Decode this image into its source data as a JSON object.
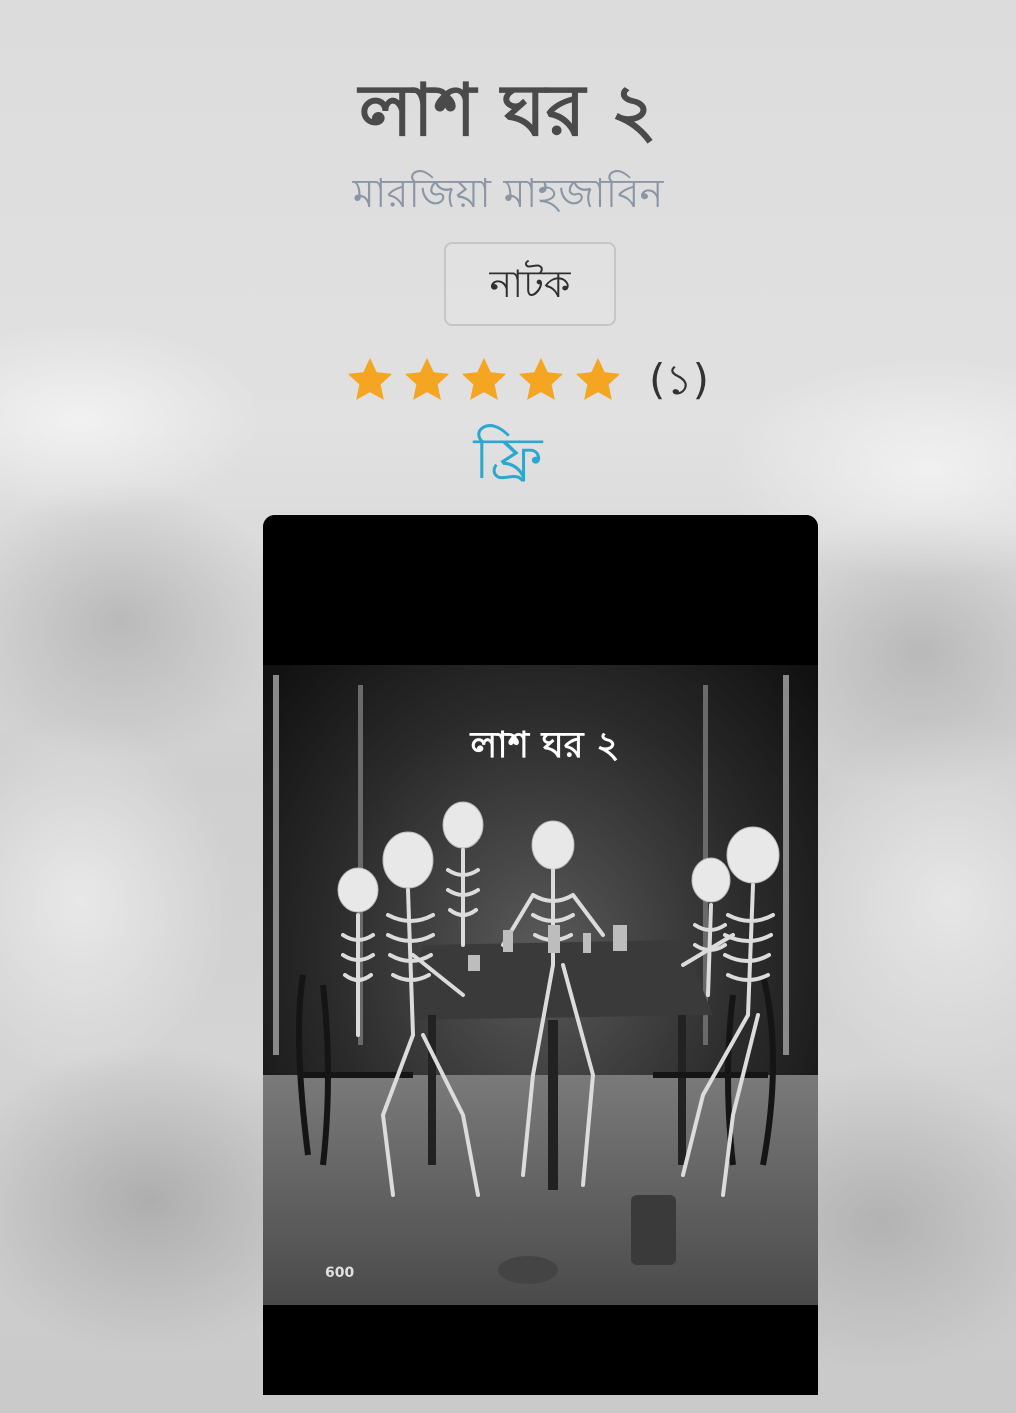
{
  "book": {
    "title": "লাশ ঘর ২",
    "author": "মারজিয়া মাহজাবিন",
    "genre": "নাটক",
    "rating": {
      "stars_filled": 5,
      "stars_total": 5,
      "count_label": "(১)"
    },
    "price": "ফ্রি",
    "cover": {
      "title_text": "লাশ ঘর ২",
      "corner_number": "600"
    }
  },
  "colors": {
    "star": "#f4a522",
    "price": "#2ba8d0",
    "author": "#8a96a5",
    "title": "#4a4a4a"
  }
}
